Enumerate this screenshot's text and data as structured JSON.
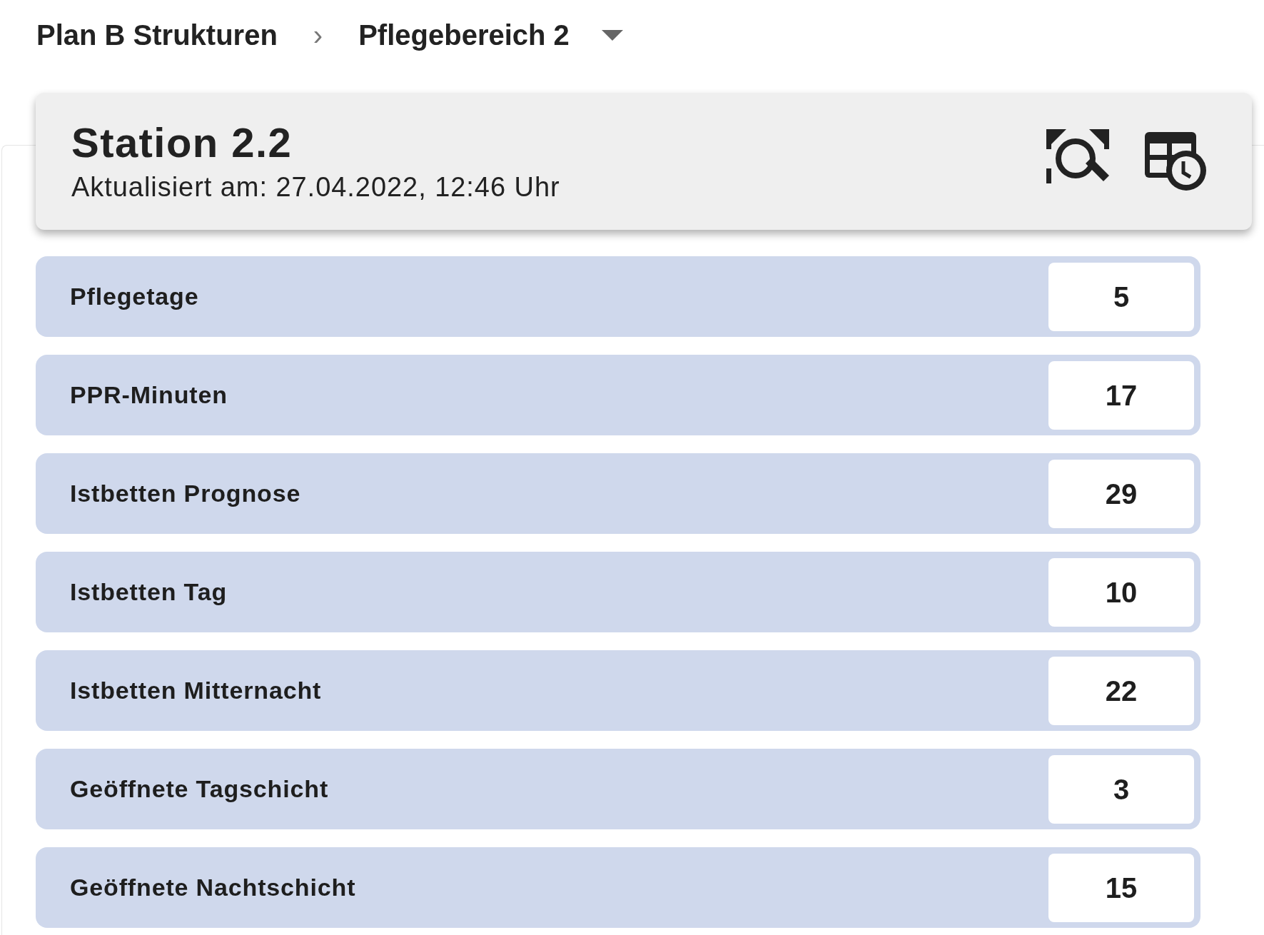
{
  "breadcrumb": [
    {
      "label": "Plan B Strukturen"
    },
    {
      "label": "Pflegebereich 2"
    }
  ],
  "breadcrumb_separator": "›",
  "header": {
    "title": "Station 2.2",
    "subtitle": "Aktualisiert am: 27.04.2022, 12:46 Uhr"
  },
  "rows": [
    {
      "label": "Pflegetage",
      "value": "5"
    },
    {
      "label": "PPR-Minuten",
      "value": "17"
    },
    {
      "label": "Istbetten Prognose",
      "value": "29"
    },
    {
      "label": "Istbetten Tag",
      "value": "10"
    },
    {
      "label": "Istbetten Mitternacht",
      "value": "22"
    },
    {
      "label": "Geöffnete Tagschicht",
      "value": "3"
    },
    {
      "label": "Geöffnete Nachtschicht",
      "value": "15"
    }
  ]
}
